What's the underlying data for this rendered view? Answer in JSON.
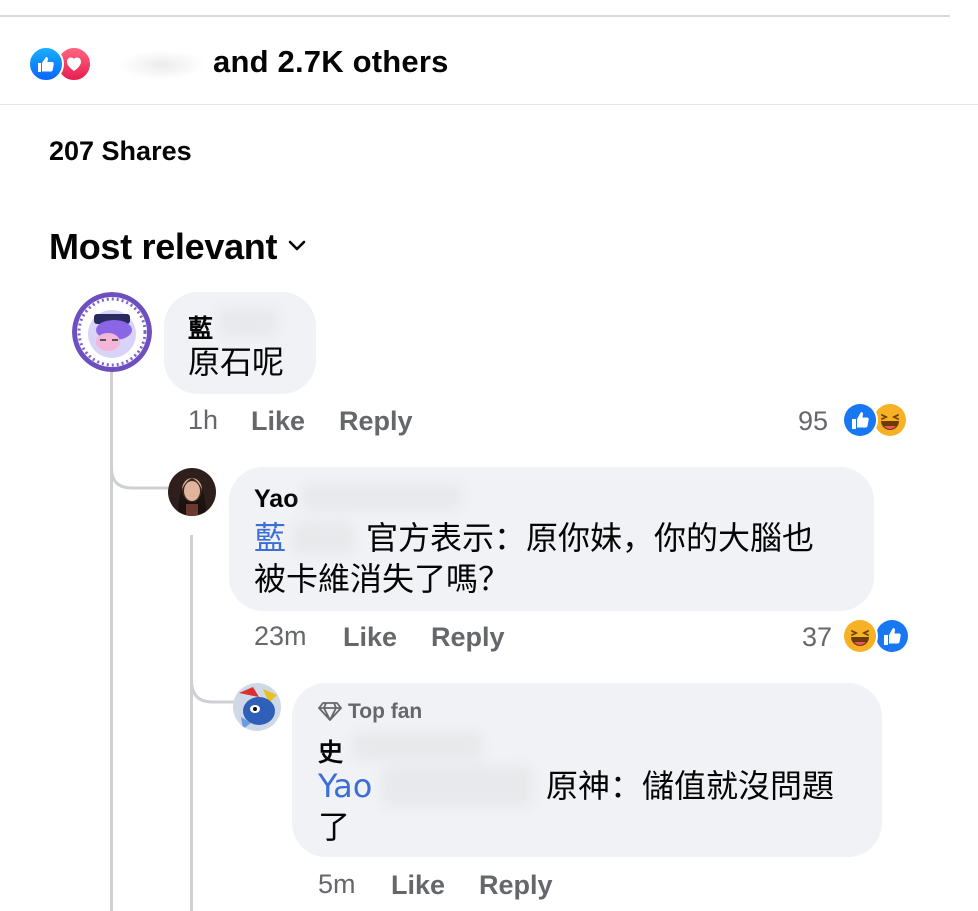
{
  "reactions": {
    "summary": "and 2.7K others",
    "icons": [
      "like-icon",
      "love-icon"
    ]
  },
  "shares": "207 Shares",
  "sort_label": "Most relevant",
  "comments": [
    {
      "author": "藍",
      "text": "原石呢",
      "time": "1h",
      "like": "Like",
      "reply": "Reply",
      "reaction_count": "95",
      "reactions": [
        "like-icon",
        "haha-icon"
      ]
    },
    {
      "author": "Yao",
      "mention": "藍",
      "text_line1": "官方表示：原你妹，你的大腦也",
      "text_line2": "被卡維消失了嗎？",
      "time": "23m",
      "like": "Like",
      "reply": "Reply",
      "reaction_count": "37",
      "reactions": [
        "haha-icon",
        "like-icon"
      ]
    },
    {
      "badge": "Top fan",
      "author": "史",
      "mention": "Yao",
      "text_line1": "原神：儲值就沒問題",
      "text_line2": "了",
      "time": "5m",
      "like": "Like",
      "reply": "Reply"
    }
  ],
  "colors": {
    "like_blue": "#0866ff",
    "love_red": "#f33e58",
    "haha_yellow": "#f7b125",
    "mention": "#3b6fd6",
    "bubble": "#f0f2f5",
    "meta": "#65676b"
  }
}
